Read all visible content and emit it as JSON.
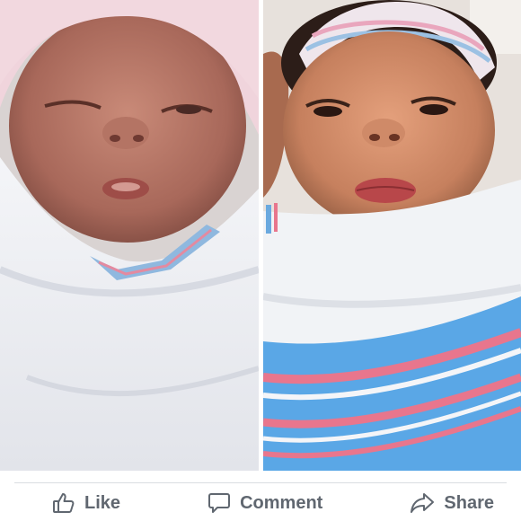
{
  "photos": {
    "left": {
      "icon": "newborn-photo-left"
    },
    "right": {
      "icon": "newborn-photo-right"
    }
  },
  "actions": {
    "like": {
      "label": "Like",
      "icon": "thumbs-up-icon"
    },
    "comment": {
      "label": "Comment",
      "icon": "comment-bubble-icon"
    },
    "share": {
      "label": "Share",
      "icon": "share-arrow-icon"
    }
  },
  "colors": {
    "action_text": "#606770",
    "divider": "#dadde1",
    "blanket_blue": "#5aa7e6",
    "blanket_pink": "#e8768d"
  }
}
